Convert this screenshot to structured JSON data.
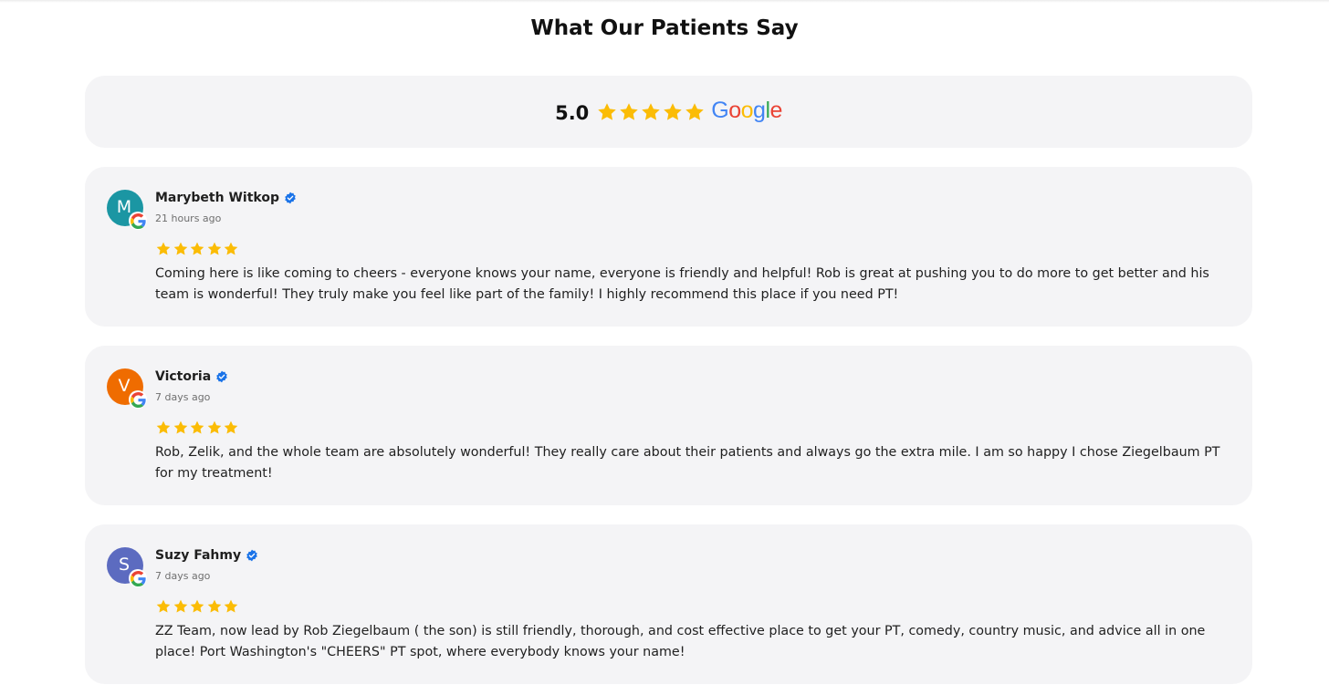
{
  "section": {
    "title": "What Our Patients Say"
  },
  "summary": {
    "rating": "5.0",
    "stars": 5,
    "brand_letters": [
      "G",
      "o",
      "o",
      "g",
      "l",
      "e"
    ],
    "brand_colors": [
      "#4285F4",
      "#EA4335",
      "#FBBC05",
      "#4285F4",
      "#34A853",
      "#EA4335"
    ]
  },
  "colors": {
    "star": "#FBBC05",
    "verified": "#1A73E8",
    "card_bg": "#F4F4F6"
  },
  "reviews": [
    {
      "initial": "M",
      "avatar_color": "#1B96A3",
      "name": "Marybeth Witkop",
      "time": "21 hours ago",
      "stars": 5,
      "text": "Coming here is like coming to cheers - everyone knows your name, everyone is friendly and helpful! Rob is great at pushing you to do more to get better and his team is wonderful! They truly make you feel like part of the family! I highly recommend this place if you need PT!"
    },
    {
      "initial": "V",
      "avatar_color": "#EF6C00",
      "name": "Victoria",
      "time": "7 days ago",
      "stars": 5,
      "text": "Rob, Zelik, and the whole team are absolutely wonderful! They really care about their patients and always go the extra mile. I am so happy I chose Ziegelbaum PT for my treatment!"
    },
    {
      "initial": "S",
      "avatar_color": "#5C6BC0",
      "name": "Suzy Fahmy",
      "time": "7 days ago",
      "stars": 5,
      "text": "ZZ Team, now lead by Rob Ziegelbaum ( the son) is still friendly, thorough, and cost effective place to get your PT, comedy, country music, and advice all in one place! Port Washington's \"CHEERS\" PT spot, where everybody knows your name!"
    }
  ]
}
